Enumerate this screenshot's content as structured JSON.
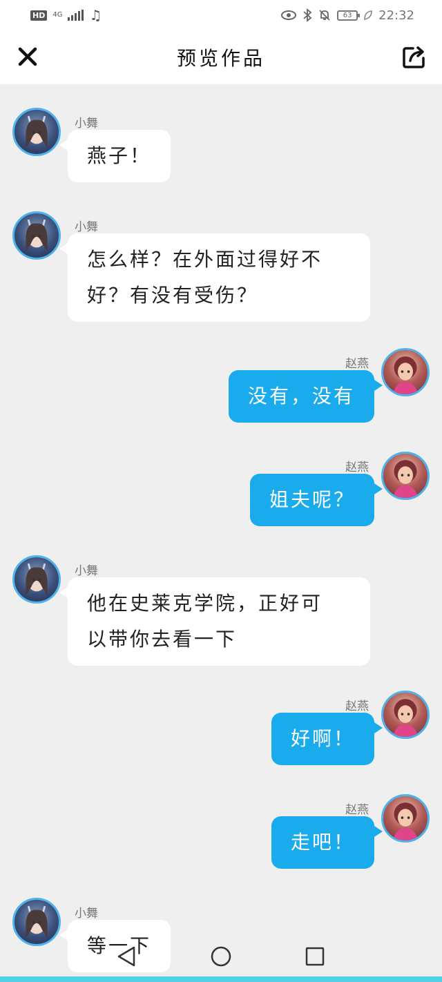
{
  "status_bar": {
    "hd": "HD",
    "network": "4G",
    "time": "22:32",
    "battery": "63"
  },
  "header": {
    "title": "预览作品"
  },
  "colors": {
    "accent": "#1aabed",
    "avatar_border": "#4fb3ea",
    "background": "#efefef"
  },
  "messages": [
    {
      "side": "left",
      "sender": "小舞",
      "text": "燕子！"
    },
    {
      "side": "left",
      "sender": "小舞",
      "text_lines": [
        "怎么样？在外面过得好不",
        "好？有没有受伤？"
      ]
    },
    {
      "side": "right",
      "sender": "赵燕",
      "text": "没有，没有"
    },
    {
      "side": "right",
      "sender": "赵燕",
      "text": "姐夫呢？"
    },
    {
      "side": "left",
      "sender": "小舞",
      "text_lines": [
        "他在史莱克学院，正好可",
        "以带你去看一下"
      ]
    },
    {
      "side": "right",
      "sender": "赵燕",
      "text": "好啊！"
    },
    {
      "side": "right",
      "sender": "赵燕",
      "text": "走吧！"
    },
    {
      "side": "left",
      "sender": "小舞",
      "text": "等一下"
    }
  ],
  "icons": {
    "close": "close-icon",
    "share": "share-icon",
    "nav_back": "back-triangle-icon",
    "nav_home": "home-circle-icon",
    "nav_recent": "recent-square-icon"
  }
}
